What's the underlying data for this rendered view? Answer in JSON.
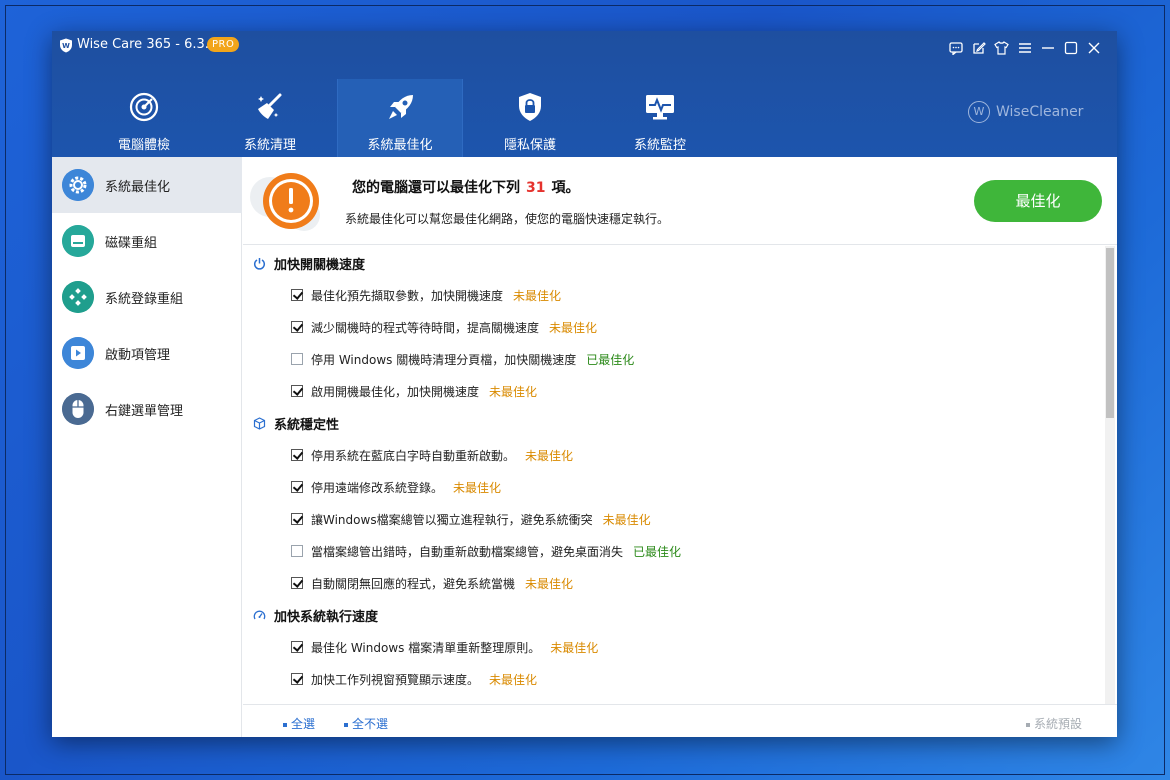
{
  "app": {
    "title": "Wise Care 365 - 6.3.2",
    "badge": "PRO",
    "brand": "WiseCleaner",
    "brand_mark": "W"
  },
  "window_controls": [
    "feedback-icon",
    "edit-icon",
    "shirt-icon",
    "menu-icon",
    "minimize-icon",
    "maximize-icon",
    "close-icon"
  ],
  "nav": [
    {
      "label": "電腦體檢",
      "icon": "radar-icon",
      "active": false
    },
    {
      "label": "系統清理",
      "icon": "broom-icon",
      "active": false
    },
    {
      "label": "系統最佳化",
      "icon": "rocket-icon",
      "active": true
    },
    {
      "label": "隱私保護",
      "icon": "privacy-lock-icon",
      "active": false
    },
    {
      "label": "系統監控",
      "icon": "monitor-icon",
      "active": false
    }
  ],
  "sidebar": [
    {
      "label": "系統最佳化",
      "icon": "gear-icon",
      "active": true
    },
    {
      "label": "磁碟重組",
      "icon": "disk-icon",
      "active": false
    },
    {
      "label": "系統登錄重組",
      "icon": "registry-icon",
      "active": false
    },
    {
      "label": "啟動項管理",
      "icon": "startup-icon",
      "active": false
    },
    {
      "label": "右鍵選單管理",
      "icon": "mouse-icon",
      "active": false
    }
  ],
  "banner": {
    "title_prefix": "您的電腦還可以最佳化下列",
    "count": "31",
    "title_suffix": "項。",
    "subtitle": "系統最佳化可以幫您最佳化網路，使您的電腦快速穩定執行。",
    "button": "最佳化"
  },
  "sections": [
    {
      "title": "加快開關機速度",
      "icon": "power-icon",
      "items": [
        {
          "text": "最佳化預先擷取參數，加快開機速度",
          "checked": true,
          "status": "未最佳化",
          "state": "pending"
        },
        {
          "text": "減少關機時的程式等待時間，提高關機速度",
          "checked": true,
          "status": "未最佳化",
          "state": "pending"
        },
        {
          "text": "停用 Windows 關機時清理分頁檔，加快關機速度",
          "checked": false,
          "status": "已最佳化",
          "state": "done"
        },
        {
          "text": "啟用開機最佳化，加快開機速度",
          "checked": true,
          "status": "未最佳化",
          "state": "pending"
        }
      ]
    },
    {
      "title": "系統穩定性",
      "icon": "cube-icon",
      "items": [
        {
          "text": "停用系統在藍底白字時自動重新啟動。",
          "checked": true,
          "status": "未最佳化",
          "state": "pending"
        },
        {
          "text": "停用遠端修改系統登錄。",
          "checked": true,
          "status": "未最佳化",
          "state": "pending"
        },
        {
          "text": "讓Windows檔案總管以獨立進程執行，避免系統衝突",
          "checked": true,
          "status": "未最佳化",
          "state": "pending"
        },
        {
          "text": "當檔案總管出錯時，自動重新啟動檔案總管，避免桌面消失",
          "checked": false,
          "status": "已最佳化",
          "state": "done"
        },
        {
          "text": "自動關閉無回應的程式，避免系統當機",
          "checked": true,
          "status": "未最佳化",
          "state": "pending"
        }
      ]
    },
    {
      "title": "加快系統執行速度",
      "icon": "speedometer-icon",
      "items": [
        {
          "text": "最佳化 Windows 檔案清單重新整理原則。",
          "checked": true,
          "status": "未最佳化",
          "state": "pending"
        },
        {
          "text": "加快工作列視窗預覽顯示速度。",
          "checked": true,
          "status": "未最佳化",
          "state": "pending"
        }
      ]
    }
  ],
  "footer": {
    "select_all": "全選",
    "select_none": "全不選",
    "default": "系統預設"
  },
  "colors": {
    "header": "#1e4fa0",
    "accent_green": "#3fb63a",
    "pending": "#d98a00",
    "done": "#2c8a1a",
    "count": "#e5322d",
    "warning": "#f07c1a"
  }
}
